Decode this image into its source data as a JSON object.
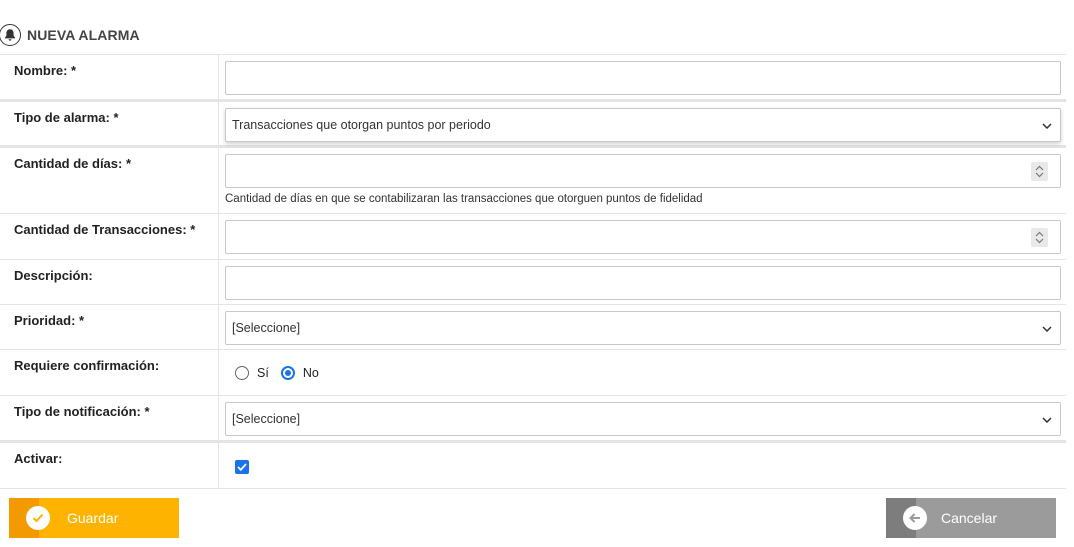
{
  "header": {
    "title": "NUEVA ALARMA",
    "icon": "bell-icon"
  },
  "form": {
    "nombre": {
      "label": "Nombre: *",
      "value": ""
    },
    "tipo_alarma": {
      "label": "Tipo de alarma: *",
      "selected": "Transacciones que otorgan puntos por periodo"
    },
    "cantidad_dias": {
      "label": "Cantidad de días: *",
      "value": "",
      "help": "Cantidad de días en que se contabilizaran las transacciones que otorguen puntos de fidelidad"
    },
    "cantidad_transacciones": {
      "label": "Cantidad de Transacciones: *",
      "value": ""
    },
    "descripcion": {
      "label": "Descripción:",
      "value": ""
    },
    "prioridad": {
      "label": "Prioridad: *",
      "selected": "[Seleccione]"
    },
    "requiere_confirmacion": {
      "label": "Requiere confirmación:",
      "options": [
        "Sí",
        "No"
      ],
      "selected": "No"
    },
    "tipo_notificacion": {
      "label": "Tipo de notificación: *",
      "selected": "[Seleccione]"
    },
    "activar": {
      "label": "Activar:",
      "checked": true
    }
  },
  "actions": {
    "save_label": "Guardar",
    "cancel_label": "Cancelar"
  },
  "colors": {
    "save": "#fdb300",
    "cancel": "#9b9b9b",
    "accent": "#1a73e8"
  }
}
